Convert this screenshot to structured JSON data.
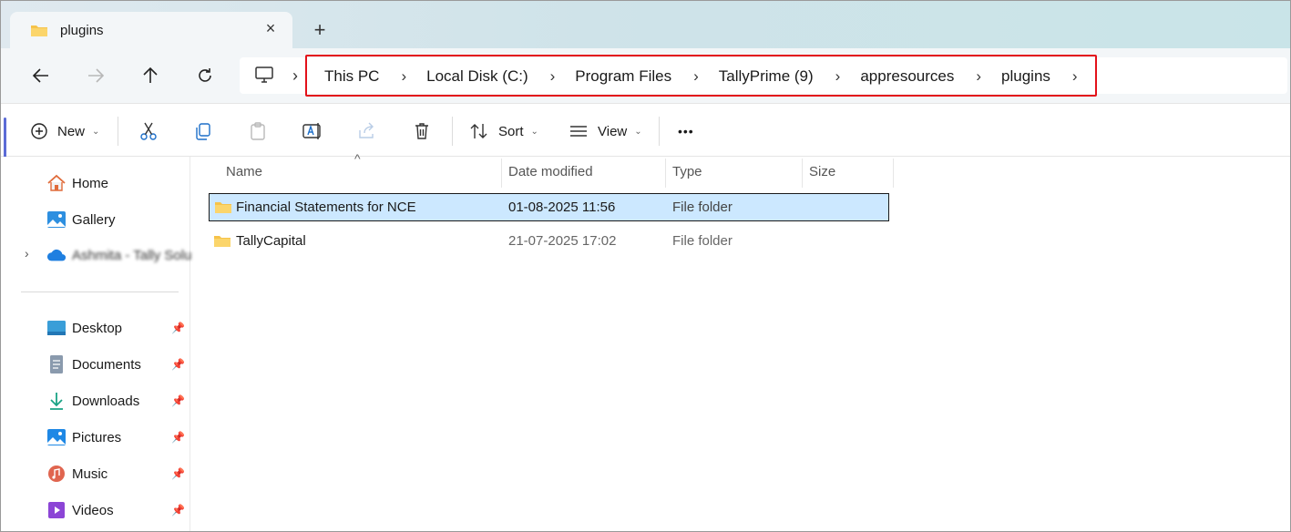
{
  "tab": {
    "title": "plugins",
    "close_glyph": "×",
    "new_tab_glyph": "+"
  },
  "nav": {
    "back_icon": "arrow-left-icon",
    "forward_icon": "arrow-right-icon",
    "up_icon": "arrow-up-icon",
    "refresh_icon": "refresh-icon",
    "breadcrumb": [
      "This PC",
      "Local Disk (C:)",
      "Program Files",
      "TallyPrime (9)",
      "appresources",
      "plugins"
    ],
    "separator": "›"
  },
  "toolbar": {
    "new_label": "New",
    "sort_label": "Sort",
    "view_label": "View",
    "more_label": "•••",
    "dropdown_glyph": "⌄"
  },
  "sidebar": {
    "home": "Home",
    "gallery": "Gallery",
    "onedrive": "Ashmita - Tally Solu",
    "pinned": [
      "Desktop",
      "Documents",
      "Downloads",
      "Pictures",
      "Music",
      "Videos"
    ],
    "pin_glyph": "📌"
  },
  "columns": {
    "name": "Name",
    "date": "Date modified",
    "type": "Type",
    "size": "Size",
    "sort_glyph": "^"
  },
  "files": [
    {
      "name": "Financial Statements for NCE",
      "date": "01-08-2025 11:56",
      "type": "File folder",
      "size": ""
    },
    {
      "name": "TallyCapital",
      "date": "21-07-2025 17:02",
      "type": "File folder",
      "size": ""
    }
  ],
  "colors": {
    "accent": "#e3111a",
    "selection": "#cce8ff",
    "folder": "#f6c34a"
  }
}
